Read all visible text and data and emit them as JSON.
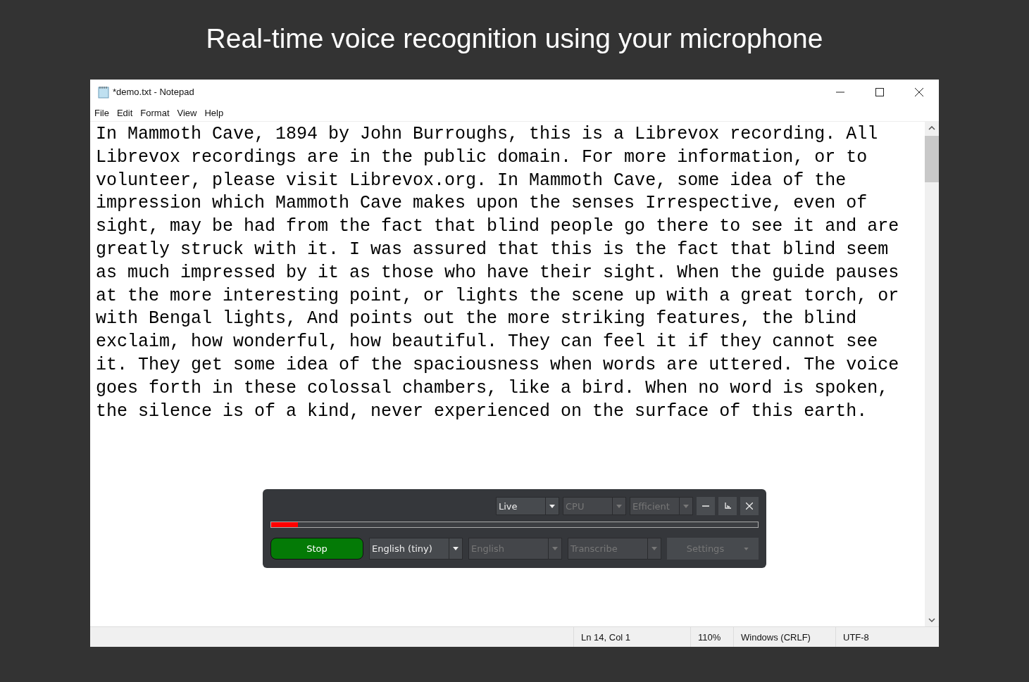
{
  "heading": "Real-time voice recognition using your microphone",
  "window": {
    "title": "*demo.txt - Notepad"
  },
  "menu": [
    "File",
    "Edit",
    "Format",
    "View",
    "Help"
  ],
  "document_lines": [
    "In Mammoth Cave, 1894 by John Burroughs, this is a Librevox recording. All",
    "Librevox recordings are in the public domain. For more information, or to",
    "volunteer, please visit Librevox.org. In Mammoth Cave, some idea of the",
    "impression which Mammoth Cave makes upon the senses Irrespective, even of",
    "sight, may be had from the fact that blind people go there to see it and are",
    "greatly struck with it. I was assured that this is the fact that blind seem",
    "as much impressed by it as those who have their sight. When the guide pauses",
    "at the more interesting point, or lights the scene up with a great torch, or",
    "with Bengal lights, And points out the more striking features, the blind",
    "exclaim, how wonderful, how beautiful. They can feel it if they cannot see",
    "it. They get some idea of the spaciousness when words are uttered. The voice",
    "goes forth in these colossal chambers, like a bird. When no word is spoken,",
    "the silence is of a kind, never experienced on the surface of this earth."
  ],
  "recognizer": {
    "top_dropdowns": [
      {
        "value": "Live",
        "disabled": false
      },
      {
        "value": "CPU",
        "disabled": true
      },
      {
        "value": "Efficient",
        "disabled": true
      }
    ],
    "audio_meter": {
      "level": 0.055
    },
    "stop_button": "Stop",
    "bottom_dropdowns": [
      {
        "value": "English (tiny)",
        "disabled": false
      },
      {
        "value": "English",
        "disabled": true
      },
      {
        "value": "Transcribe",
        "disabled": true
      }
    ],
    "settings_button": {
      "label": "Settings",
      "disabled": true
    }
  },
  "status_bar": [
    "Ln 14, Col 1",
    "110%",
    "Windows (CRLF)",
    "UTF-8"
  ]
}
